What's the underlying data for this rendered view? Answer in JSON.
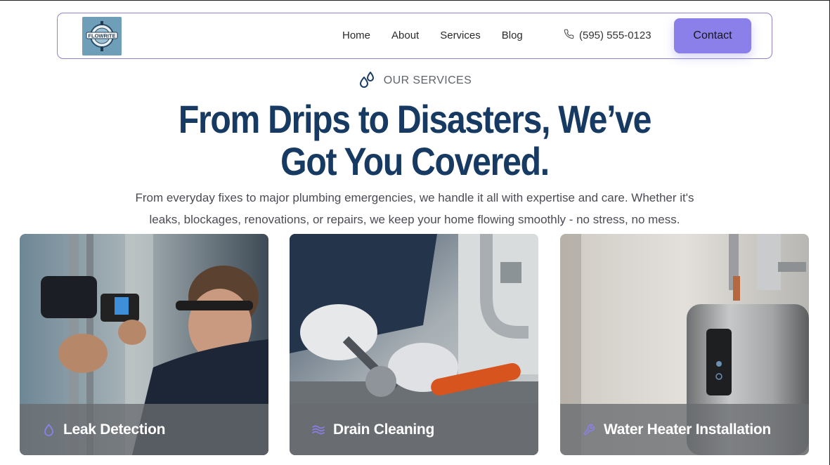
{
  "brand": {
    "logo_text": "FLOWRITE"
  },
  "nav": {
    "links": [
      "Home",
      "About",
      "Services",
      "Blog"
    ],
    "phone": "(595) 555-0123",
    "contact_label": "Contact"
  },
  "hero": {
    "eyebrow": "OUR SERVICES",
    "headline": "From Drips to Disasters, We’ve Got You Covered.",
    "subtext": "From everyday fixes to major plumbing emergencies, we handle it all with expertise and care. Whether it's leaks, blockages, renovations, or repairs, we keep your home flowing smoothly -  no stress, no mess."
  },
  "services": [
    {
      "title": "Leak Detection",
      "icon": "droplet-icon"
    },
    {
      "title": "Drain Cleaning",
      "icon": "waves-icon"
    },
    {
      "title": "Water Heater Installation",
      "icon": "wrench-icon"
    }
  ],
  "colors": {
    "accent": "#8b80ea",
    "headline": "#173a63",
    "nav_border": "#8c84d9"
  }
}
